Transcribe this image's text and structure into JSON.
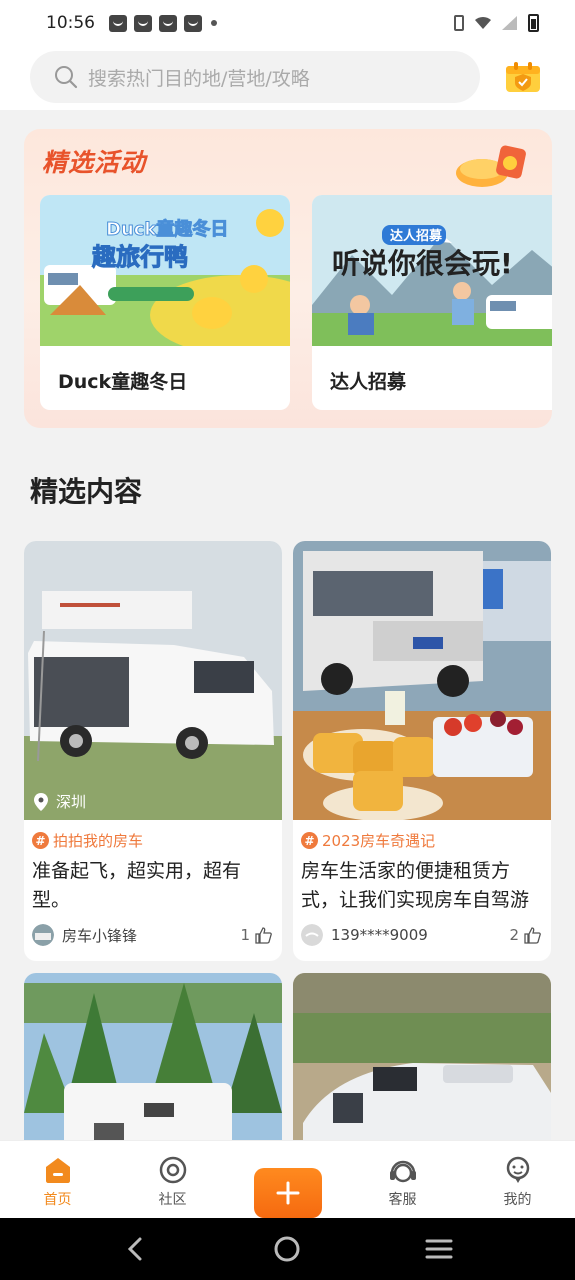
{
  "status_bar": {
    "time": "10:56"
  },
  "search": {
    "placeholder": "搜索热门目的地/营地/攻略"
  },
  "activities": {
    "title": "精选活动",
    "items": [
      {
        "label": "Duck童趣冬日",
        "image_text": "Duck童趣冬日 趣旅行鸭"
      },
      {
        "label": "达人招募",
        "image_text": "达人招募 听说你很会玩!"
      }
    ]
  },
  "content": {
    "title": "精选内容",
    "cards": [
      {
        "location": "深圳",
        "topic": "拍拍我的房车",
        "title": "准备起飞，超实用，超有型。",
        "author": "房车小锋锋",
        "likes": "1"
      },
      {
        "topic": "2023房车奇遇记",
        "title": "房车生活家的便捷租赁方式，让我们实现房车自驾游",
        "author": "139****9009",
        "likes": "2"
      }
    ]
  },
  "tab_bar": {
    "items": [
      {
        "label": "首页",
        "icon": "home-icon",
        "active": true
      },
      {
        "label": "社区",
        "icon": "community-icon",
        "active": false
      },
      {
        "label": "",
        "icon": "plus-icon",
        "active": false
      },
      {
        "label": "客服",
        "icon": "headset-icon",
        "active": false
      },
      {
        "label": "我的",
        "icon": "profile-icon",
        "active": false
      }
    ]
  },
  "colors": {
    "accent": "#f28a1e",
    "topic": "#ef7a3d",
    "activity_title": "#e8532b"
  }
}
